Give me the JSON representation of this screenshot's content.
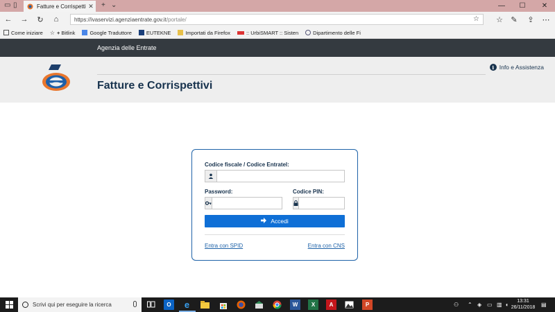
{
  "browser": {
    "tab_title": "Fatture e Corrispettivi",
    "tab_close": "✕",
    "new_tab": "+",
    "tab_list": "⌄",
    "window_controls": {
      "minimize": "—",
      "maximize": "☐",
      "close": "✕"
    },
    "url_host": "https://ivaservizi.agenziaentrate.gov.it",
    "url_path": "/portale/",
    "favorites": [
      {
        "label": "Come iniziare",
        "icon": "document-icon"
      },
      {
        "label": "Bitlink",
        "icon": "star-plus-icon"
      },
      {
        "label": "Google Traduttore",
        "icon": "translate-icon"
      },
      {
        "label": "EUTEKNE",
        "icon": "eutekne-icon"
      },
      {
        "label": "Importati da Firefox",
        "icon": "folder-icon"
      },
      {
        "label": ":: UrbiSMART :: Sisten",
        "icon": "urbismart-icon"
      },
      {
        "label": "Dipartimento delle Fi",
        "icon": "department-icon"
      }
    ]
  },
  "site": {
    "agency": "Agenzia delle Entrate",
    "title": "Fatture e Corrispettivi",
    "info_link": "Info e Assistenza"
  },
  "login": {
    "cf_label": "Codice fiscale / Codice Entratel:",
    "password_label": "Password:",
    "pin_label": "Codice PIN:",
    "cf_value": "",
    "password_value": "",
    "pin_value": "",
    "submit": "Accedi",
    "spid_link": "Entra con SPID",
    "cns_link": "Entra con CNS"
  },
  "taskbar": {
    "search_placeholder": "Scrivi qui per eseguire la ricerca",
    "time": "13:31",
    "date": "26/11/2018"
  },
  "colors": {
    "site_topbar": "#343a40",
    "brand_blue": "#17324d",
    "accent": "#0f6fd6",
    "card_border": "#1e62a8"
  }
}
